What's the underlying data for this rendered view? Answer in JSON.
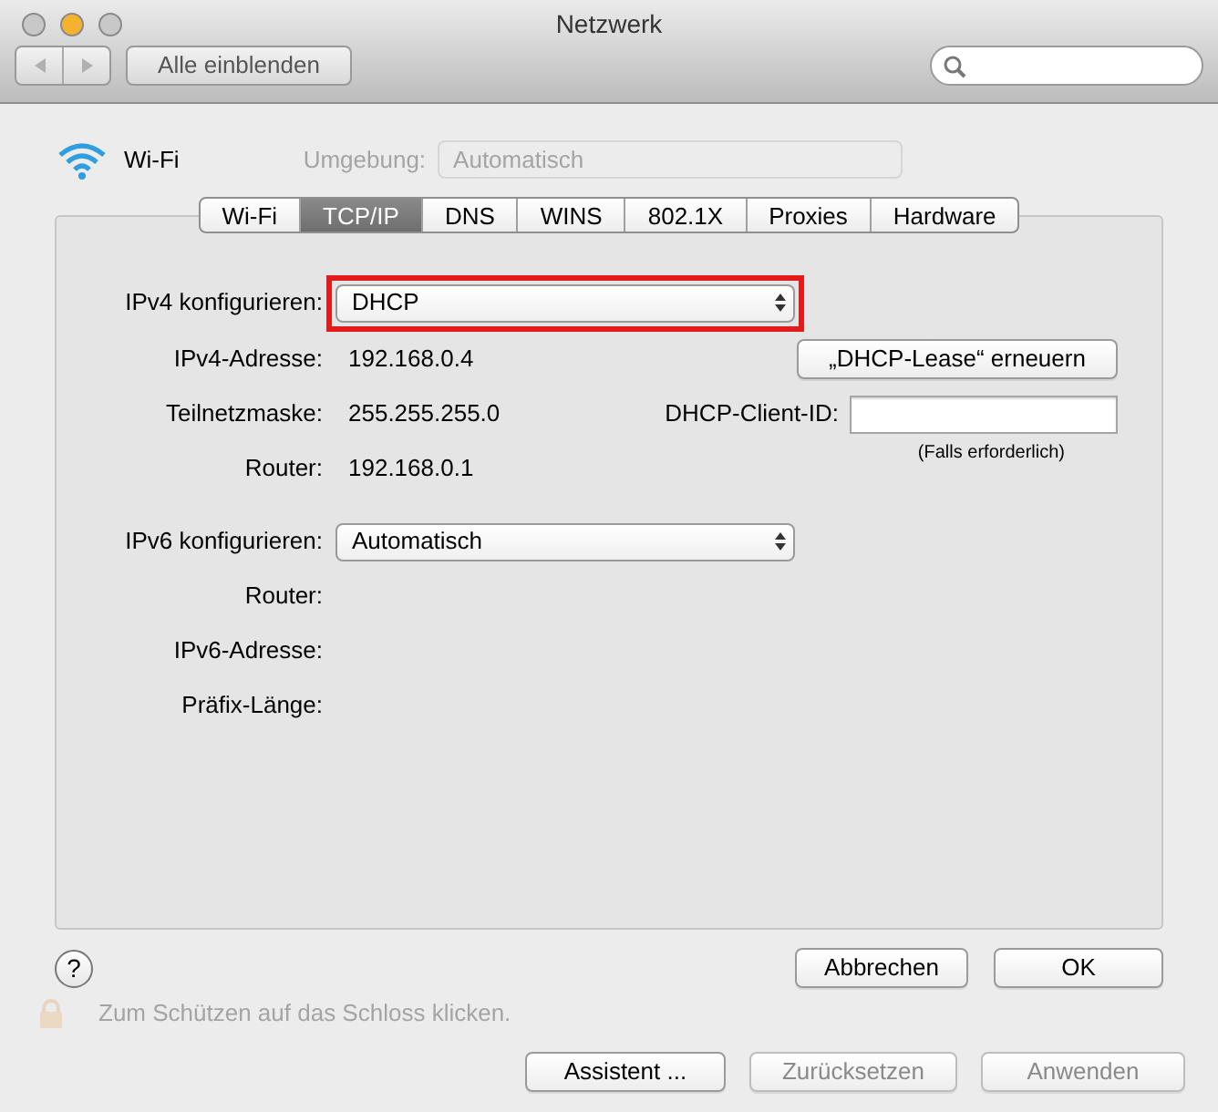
{
  "window": {
    "title": "Netzwerk"
  },
  "toolbar": {
    "show_all_button": "Alle einblenden"
  },
  "background": {
    "location_label": "Umgebung:",
    "location_value": "Automatisch",
    "lock_hint": "Zum Schützen auf das Schloss klicken."
  },
  "sheet": {
    "service": "Wi-Fi",
    "tabs": [
      {
        "label": "Wi-Fi",
        "selected": false
      },
      {
        "label": "TCP/IP",
        "selected": true
      },
      {
        "label": "DNS",
        "selected": false
      },
      {
        "label": "WINS",
        "selected": false
      },
      {
        "label": "802.1X",
        "selected": false
      },
      {
        "label": "Proxies",
        "selected": false
      },
      {
        "label": "Hardware",
        "selected": false
      }
    ],
    "ipv4": {
      "label": "IPv4 konfigurieren:",
      "value": "DHCP",
      "highlighted": true
    },
    "info_rows": [
      {
        "label": "IPv4-Adresse:",
        "value": "192.168.0.4"
      },
      {
        "label": "Teilnetzmaske:",
        "value": "255.255.255.0"
      },
      {
        "label": "Router:",
        "value": "192.168.0.1"
      }
    ],
    "renew_button": "„DHCP-Lease“ erneuern",
    "client_id": {
      "label": "DHCP-Client-ID:",
      "hint": "(Falls erforderlich)"
    },
    "ipv6": {
      "label": "IPv6 konfigurieren:",
      "value": "Automatisch"
    },
    "ipv6_rows": [
      {
        "label": "Router:"
      },
      {
        "label": "IPv6-Adresse:"
      },
      {
        "label": "Präfix-Länge:"
      }
    ],
    "help_button": "?",
    "buttons": [
      {
        "label": "Abbrechen"
      },
      {
        "label": "OK"
      }
    ]
  },
  "footer_buttons": [
    {
      "label": "Assistent ...",
      "disabled": false
    },
    {
      "label": "Zurücksetzen",
      "disabled": true
    },
    {
      "label": "Anwenden",
      "disabled": true
    }
  ]
}
